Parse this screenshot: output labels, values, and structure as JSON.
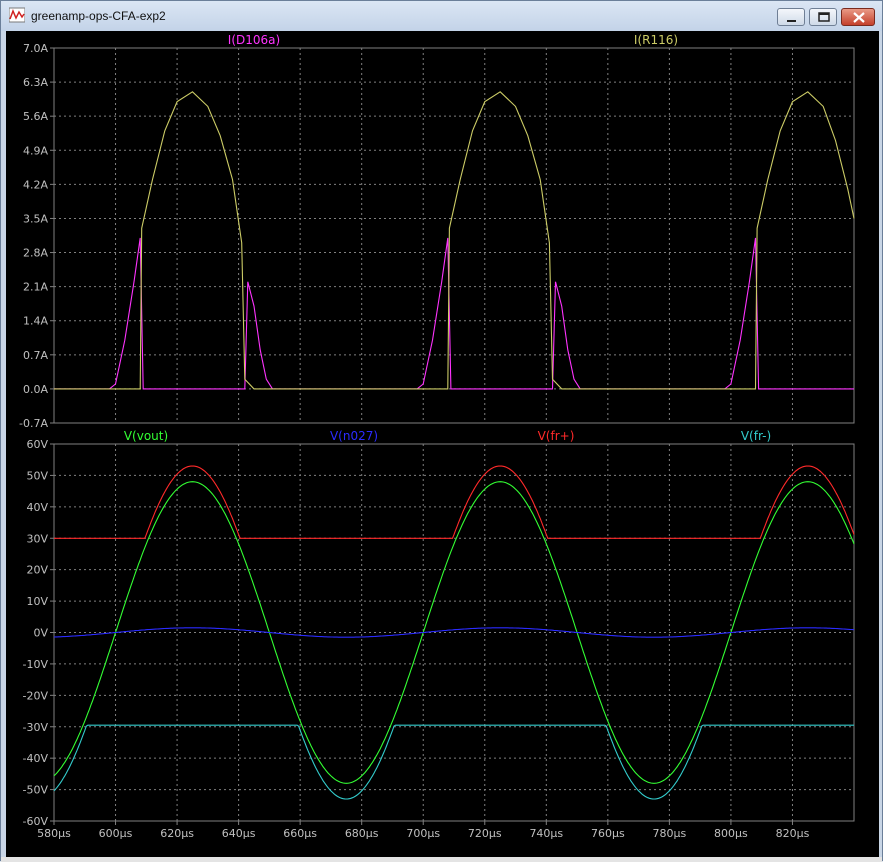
{
  "window": {
    "title": "greenamp-ops-CFA-exp2",
    "icon": "waveform-icon",
    "buttons": [
      "minimize",
      "maximize",
      "close"
    ]
  },
  "colors": {
    "background": "#000000",
    "grid": "#808080",
    "axis_text": "#c0c0c0",
    "I_D106a": "#ff33ff",
    "I_R116": "#cccc66",
    "V_vout": "#33ff33",
    "V_n027": "#2b2bff",
    "V_frp": "#ff2a2a",
    "V_frm": "#33cccc"
  },
  "chart_data": [
    {
      "type": "line",
      "name": "current-pane",
      "xlabel": "",
      "ylabel": "",
      "xlim": [
        580,
        840
      ],
      "ylim": [
        -0.7,
        7.0
      ],
      "y_ticks": [
        "7.0A",
        "6.3A",
        "5.6A",
        "4.9A",
        "4.2A",
        "3.5A",
        "2.8A",
        "2.1A",
        "1.4A",
        "0.7A",
        "0.0A",
        "-0.7A"
      ],
      "grid": true,
      "series": [
        {
          "name": "I(D106a)",
          "color": "#ff33ff",
          "points": [
            [
              580,
              0
            ],
            [
              598,
              0
            ],
            [
              600,
              0.1
            ],
            [
              603,
              1.0
            ],
            [
              606,
              2.2
            ],
            [
              608,
              3.1
            ],
            [
              609,
              0
            ],
            [
              642,
              0
            ],
            [
              643,
              2.2
            ],
            [
              645,
              1.7
            ],
            [
              647,
              0.8
            ],
            [
              649,
              0.2
            ],
            [
              651,
              0
            ],
            [
              698,
              0
            ],
            [
              700,
              0.1
            ],
            [
              703,
              1.0
            ],
            [
              706,
              2.2
            ],
            [
              708,
              3.1
            ],
            [
              709,
              0
            ],
            [
              742,
              0
            ],
            [
              743,
              2.2
            ],
            [
              745,
              1.7
            ],
            [
              747,
              0.8
            ],
            [
              749,
              0.2
            ],
            [
              751,
              0
            ],
            [
              798,
              0
            ],
            [
              800,
              0.1
            ],
            [
              803,
              1.0
            ],
            [
              806,
              2.2
            ],
            [
              808,
              3.1
            ],
            [
              809,
              0
            ],
            [
              840,
              0
            ]
          ]
        },
        {
          "name": "I(R116)",
          "color": "#cccc66",
          "points": [
            [
              580,
              0
            ],
            [
              608,
              0
            ],
            [
              608.5,
              3.3
            ],
            [
              612,
              4.3
            ],
            [
              616,
              5.3
            ],
            [
              620,
              5.9
            ],
            [
              625,
              6.1
            ],
            [
              630,
              5.8
            ],
            [
              634,
              5.2
            ],
            [
              638,
              4.3
            ],
            [
              641,
              3.0
            ],
            [
              642,
              0.2
            ],
            [
              645,
              0
            ],
            [
              708,
              0
            ],
            [
              708.5,
              3.3
            ],
            [
              712,
              4.3
            ],
            [
              716,
              5.3
            ],
            [
              720,
              5.9
            ],
            [
              725,
              6.1
            ],
            [
              730,
              5.8
            ],
            [
              734,
              5.2
            ],
            [
              738,
              4.3
            ],
            [
              741,
              3.0
            ],
            [
              742,
              0.2
            ],
            [
              745,
              0
            ],
            [
              808,
              0
            ],
            [
              808.5,
              3.3
            ],
            [
              812,
              4.3
            ],
            [
              816,
              5.3
            ],
            [
              820,
              5.9
            ],
            [
              825,
              6.1
            ],
            [
              830,
              5.8
            ],
            [
              834,
              5.1
            ],
            [
              838,
              4.1
            ],
            [
              840,
              3.5
            ]
          ]
        }
      ]
    },
    {
      "type": "line",
      "name": "voltage-pane",
      "xlabel": "",
      "ylabel": "",
      "xlim": [
        580,
        840
      ],
      "ylim": [
        -60,
        60
      ],
      "y_ticks": [
        "60V",
        "50V",
        "40V",
        "30V",
        "20V",
        "10V",
        "0V",
        "-10V",
        "-20V",
        "-30V",
        "-40V",
        "-50V",
        "-60V"
      ],
      "x_ticks": [
        "580µs",
        "600µs",
        "620µs",
        "640µs",
        "660µs",
        "680µs",
        "700µs",
        "720µs",
        "740µs",
        "760µs",
        "780µs",
        "800µs",
        "820µs"
      ],
      "grid": true,
      "series": [
        {
          "name": "V(vout)",
          "color": "#33ff33",
          "kind": "sine",
          "amp": 48,
          "period": 100,
          "peak_at": 625
        },
        {
          "name": "V(n027)",
          "color": "#2b2bff",
          "kind": "sine",
          "amp": 1.5,
          "period": 100,
          "peak_at": 625
        },
        {
          "name": "V(fr+)",
          "color": "#ff2a2a",
          "kind": "clip_low",
          "amp": 53,
          "period": 100,
          "peak_at": 625,
          "floor": 30
        },
        {
          "name": "V(fr-)",
          "color": "#33cccc",
          "kind": "clip_high",
          "amp": 53,
          "period": 100,
          "peak_at": 625,
          "ceiling": -29.5
        }
      ]
    }
  ]
}
